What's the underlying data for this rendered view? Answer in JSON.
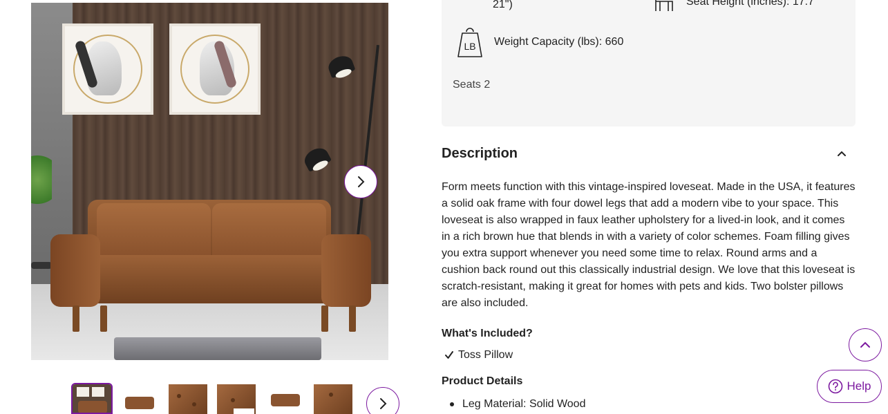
{
  "colors": {
    "accent": "#7b189f",
    "panel": "#f5f5f5",
    "text": "#222222"
  },
  "gallery": {
    "main_image_alt": "Brown faux leather loveseat in a living room",
    "next_icon": "chevron-right-icon",
    "thumbnail_count": 6
  },
  "specs": {
    "seat_height_fragment": "Seat Height (inches): 17.7",
    "overall_fragment": "21\")",
    "weight_capacity": "Weight Capacity (lbs): 660",
    "weight_icon_text": "LB",
    "seats": "Seats 2"
  },
  "description": {
    "title": "Description",
    "body": "Form meets function with this vintage-inspired loveseat. Made in the USA, it features a solid oak frame with four dowel legs that add a modern vibe to your space. This loveseat is also wrapped in faux leather upholstery for a lived-in look, and it comes in a rich brown hue that blends in with a variety of color schemes. Foam filling gives you extra support whenever you need some time to relax. Round arms and a cushion back round out this classically industrial design. We love that this loveseat is scratch-resistant, making it great for homes with pets and kids. Two bolster pillows are also included.",
    "whats_included_title": "What's Included?",
    "whats_included_items": [
      "Toss Pillow"
    ],
    "product_details_title": "Product Details",
    "product_details_items": [
      "Leg Material: Solid Wood"
    ]
  },
  "floating": {
    "help_label": "Help"
  }
}
